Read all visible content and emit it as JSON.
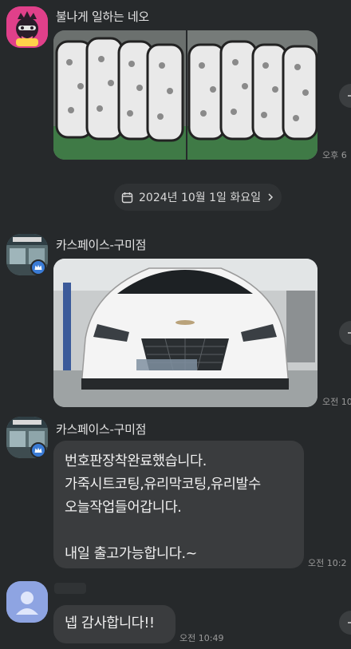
{
  "messages": [
    {
      "sender": "불나게 일하는 네오",
      "time": "오후 6"
    },
    {
      "date_separator": "2024년 10월 1일 화요일"
    },
    {
      "sender": "카스페이스-구미점",
      "time": "오전 10"
    },
    {
      "sender": "카스페이스-구미점",
      "lines": [
        "번호판장착완료했습니다.",
        "가죽시트코팅,유리막코팅,유리발수",
        "오늘작업들어갑니다.",
        "",
        "내일 출고가능합니다.~"
      ],
      "time": "오전 10:2"
    },
    {
      "text": "넵 감사합니다!!",
      "time": "오전 10:49"
    }
  ],
  "colors": {
    "background": "#26292b",
    "bubble": "#3a3c3e",
    "neo_avatar": "#e0408a",
    "verified_badge": "#3a7bd5"
  }
}
